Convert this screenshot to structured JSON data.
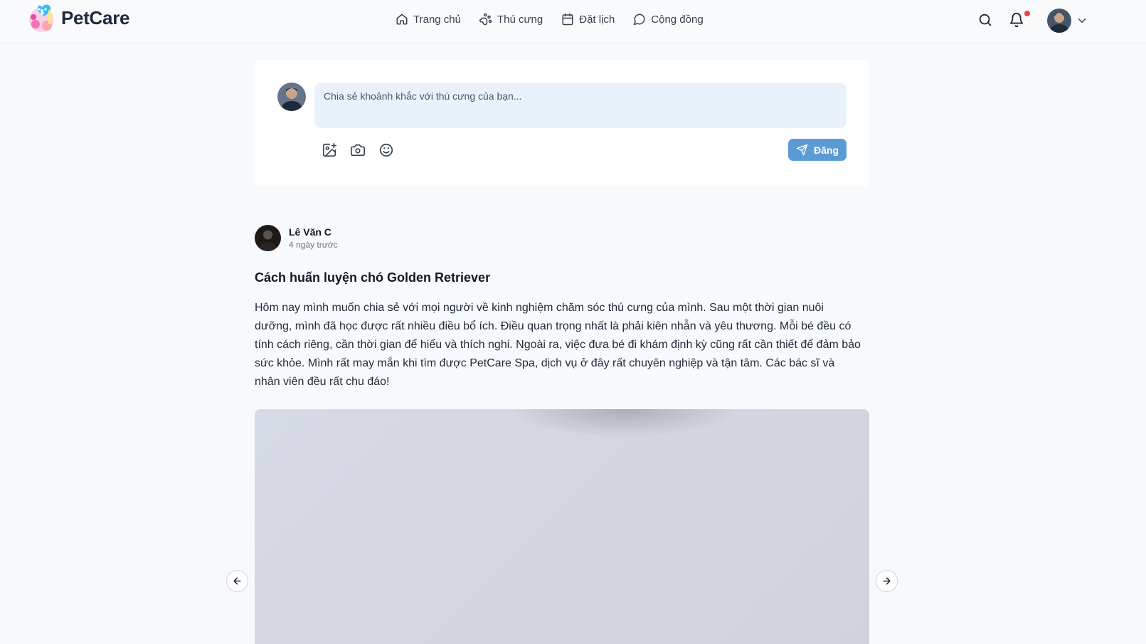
{
  "header": {
    "brand": "PetCare",
    "nav": [
      {
        "label": "Trang chủ",
        "icon": "home-icon"
      },
      {
        "label": "Thú cưng",
        "icon": "paw-icon"
      },
      {
        "label": "Đặt lịch",
        "icon": "calendar-icon"
      },
      {
        "label": "Cộng đồng",
        "icon": "chat-icon"
      }
    ],
    "icons": [
      "search-icon",
      "bell-icon",
      "chevron-down-icon"
    ],
    "notification_dot_color": "#ef4444"
  },
  "composer": {
    "placeholder": "Chia sẻ khoảnh khắc với thú cưng của bạn...",
    "tools": [
      "image-add-icon",
      "camera-icon",
      "emoji-icon"
    ],
    "post_label": "Đăng",
    "accent_color": "#5b9bd5"
  },
  "post": {
    "author": "Lê Văn C",
    "time": "4 ngày trước",
    "title": "Cách huấn luyện chó Golden Retriever",
    "body": "Hôm nay mình muốn chia sẻ với mọi người về kinh nghiệm chăm sóc thú cưng của mình. Sau một thời gian nuôi dưỡng, mình đã học được rất nhiều điều bổ ích. Điều quan trọng nhất là phải kiên nhẫn và yêu thương. Mỗi bé đều có tính cách riêng, cần thời gian để hiểu và thích nghi. Ngoài ra, việc đưa bé đi khám định kỳ cũng rất cần thiết để đảm bảo sức khỏe. Mình rất may mắn khi tìm được PetCare Spa, dịch vụ ở đây rất chuyên nghiệp và tận tâm. Các bác sĩ và nhân viên đều rất chu đáo!"
  }
}
